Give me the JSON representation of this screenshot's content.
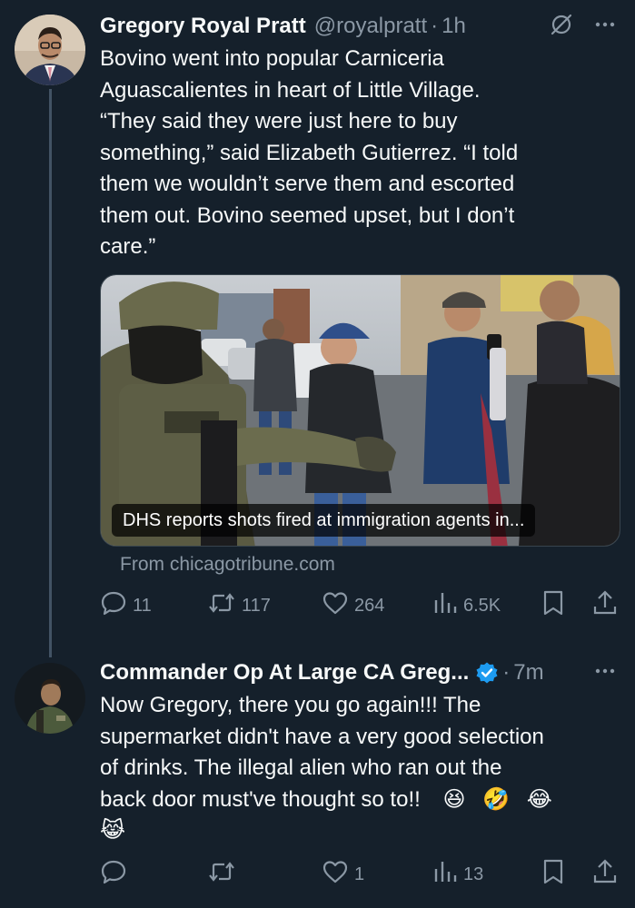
{
  "tweet1": {
    "author_name": "Gregory Royal Pratt",
    "handle": "@royalpratt",
    "separator": "·",
    "time": "1h",
    "text_lines": [
      "Bovino went into popular Carniceria",
      "Aguascalientes in heart of Little Village.",
      "“They said they were just here to buy",
      "something,” said Elizabeth Gutierrez. “I told",
      "them we wouldn’t serve them and escorted",
      "them out. Bovino seemed upset, but I don’t",
      "care.”"
    ],
    "card": {
      "caption": "DHS reports shots fired at immigration agents in...",
      "source": "From chicagotribune.com"
    },
    "stats": {
      "replies": "11",
      "reposts": "117",
      "likes": "264",
      "views": "6.5K"
    }
  },
  "tweet2": {
    "author_name": "Commander Op At Large CA Greg...",
    "separator": "·",
    "time": "7m",
    "text_lines": [
      "Now Gregory, there you go again!!!  The",
      "supermarket didn't have a very good selection",
      "of drinks.  The illegal alien who ran out the",
      "back door must've thought so to!!"
    ],
    "emojis": [
      "😆",
      "🤣",
      "😂",
      "😹"
    ],
    "stats": {
      "replies": "",
      "reposts": "",
      "likes": "1",
      "views": "13"
    }
  },
  "colors": {
    "background": "#15202b",
    "text": "#f7f9f9",
    "muted": "#8b98a5",
    "verified": "#1d9bf0",
    "thread_line": "#425364"
  },
  "icons": [
    "grok-icon",
    "more-icon",
    "reply-icon",
    "repost-icon",
    "like-icon",
    "views-icon",
    "bookmark-icon",
    "share-icon",
    "verified-icon"
  ]
}
